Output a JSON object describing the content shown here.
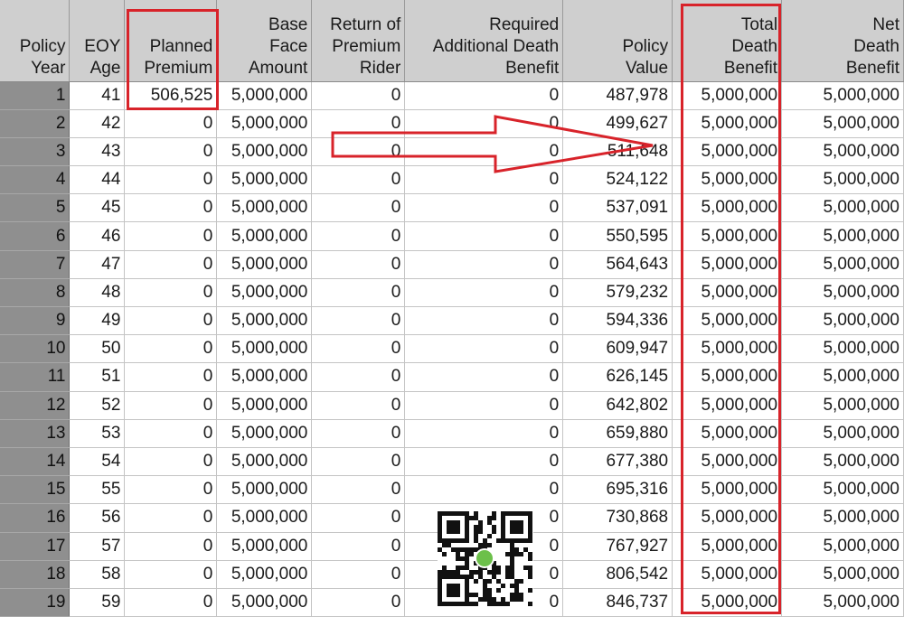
{
  "columns": [
    {
      "key": "year",
      "lines": [
        "Policy",
        "Year"
      ]
    },
    {
      "key": "age",
      "lines": [
        "EOY",
        "Age"
      ]
    },
    {
      "key": "premium",
      "lines": [
        "Planned",
        "Premium"
      ]
    },
    {
      "key": "face",
      "lines": [
        "Base",
        "Face",
        "Amount"
      ]
    },
    {
      "key": "rop",
      "lines": [
        "Return of",
        "Premium",
        "Rider"
      ]
    },
    {
      "key": "addl",
      "lines": [
        "Required",
        "Additional Death",
        "Benefit"
      ]
    },
    {
      "key": "value",
      "lines": [
        "Policy",
        "Value"
      ]
    },
    {
      "key": "total",
      "lines": [
        "Total",
        "Death",
        "Benefit"
      ]
    },
    {
      "key": "net",
      "lines": [
        "Net",
        "Death",
        "Benefit"
      ]
    }
  ],
  "rows": [
    [
      "1",
      "41",
      "506,525",
      "5,000,000",
      "0",
      "0",
      "487,978",
      "5,000,000",
      "5,000,000"
    ],
    [
      "2",
      "42",
      "0",
      "5,000,000",
      "0",
      "0",
      "499,627",
      "5,000,000",
      "5,000,000"
    ],
    [
      "3",
      "43",
      "0",
      "5,000,000",
      "0",
      "0",
      "511,648",
      "5,000,000",
      "5,000,000"
    ],
    [
      "4",
      "44",
      "0",
      "5,000,000",
      "0",
      "0",
      "524,122",
      "5,000,000",
      "5,000,000"
    ],
    [
      "5",
      "45",
      "0",
      "5,000,000",
      "0",
      "0",
      "537,091",
      "5,000,000",
      "5,000,000"
    ],
    [
      "6",
      "46",
      "0",
      "5,000,000",
      "0",
      "0",
      "550,595",
      "5,000,000",
      "5,000,000"
    ],
    [
      "7",
      "47",
      "0",
      "5,000,000",
      "0",
      "0",
      "564,643",
      "5,000,000",
      "5,000,000"
    ],
    [
      "8",
      "48",
      "0",
      "5,000,000",
      "0",
      "0",
      "579,232",
      "5,000,000",
      "5,000,000"
    ],
    [
      "9",
      "49",
      "0",
      "5,000,000",
      "0",
      "0",
      "594,336",
      "5,000,000",
      "5,000,000"
    ],
    [
      "10",
      "50",
      "0",
      "5,000,000",
      "0",
      "0",
      "609,947",
      "5,000,000",
      "5,000,000"
    ],
    [
      "11",
      "51",
      "0",
      "5,000,000",
      "0",
      "0",
      "626,145",
      "5,000,000",
      "5,000,000"
    ],
    [
      "12",
      "52",
      "0",
      "5,000,000",
      "0",
      "0",
      "642,802",
      "5,000,000",
      "5,000,000"
    ],
    [
      "13",
      "53",
      "0",
      "5,000,000",
      "0",
      "0",
      "659,880",
      "5,000,000",
      "5,000,000"
    ],
    [
      "14",
      "54",
      "0",
      "5,000,000",
      "0",
      "0",
      "677,380",
      "5,000,000",
      "5,000,000"
    ],
    [
      "15",
      "55",
      "0",
      "5,000,000",
      "0",
      "0",
      "695,316",
      "5,000,000",
      "5,000,000"
    ],
    [
      "16",
      "56",
      "0",
      "5,000,000",
      "0",
      "0",
      "730,868",
      "5,000,000",
      "5,000,000"
    ],
    [
      "17",
      "57",
      "0",
      "5,000,000",
      "0",
      "0",
      "767,927",
      "5,000,000",
      "5,000,000"
    ],
    [
      "18",
      "58",
      "0",
      "5,000,000",
      "0",
      "0",
      "806,542",
      "5,000,000",
      "5,000,000"
    ],
    [
      "19",
      "59",
      "0",
      "5,000,000",
      "0",
      "0",
      "846,737",
      "5,000,000",
      "5,000,000"
    ]
  ],
  "colors": {
    "highlight": "#d8232a",
    "header_bg": "#cfcfcf",
    "year_bg": "#8f8f8f"
  },
  "icons": {
    "overlay": "qr-code-icon",
    "pointer": "right-arrow-icon"
  }
}
